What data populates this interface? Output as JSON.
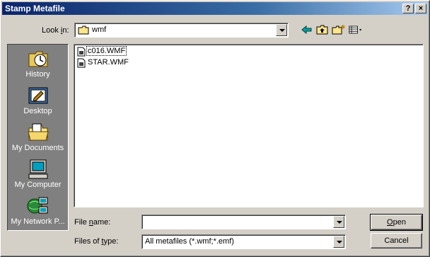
{
  "window": {
    "title": "Stamp Metafile",
    "help_btn": "?",
    "close_btn": "×"
  },
  "look_in": {
    "label_pre": "Look ",
    "label_key": "i",
    "label_post": "n:",
    "value": "wmf"
  },
  "places": [
    {
      "label": "History",
      "icon": "history-icon"
    },
    {
      "label": "Desktop",
      "icon": "desktop-icon"
    },
    {
      "label": "My Documents",
      "icon": "my-documents-icon"
    },
    {
      "label": "My Computer",
      "icon": "my-computer-icon"
    },
    {
      "label": "My Network P...",
      "icon": "my-network-places-icon"
    }
  ],
  "files": [
    {
      "name": "c016.WMF",
      "icon": "wmf-file-icon"
    },
    {
      "name": "STAR.WMF",
      "icon": "wmf-file-icon"
    }
  ],
  "file_name": {
    "label_pre": "File ",
    "label_key": "n",
    "label_post": "ame:",
    "value": ""
  },
  "file_type": {
    "label_pre": "Files of ",
    "label_key": "t",
    "label_post": "ype:",
    "value": "All metafiles (*.wmf;*.emf)"
  },
  "buttons": {
    "open_key": "O",
    "open_rest": "pen",
    "cancel": "Cancel"
  },
  "colors": {
    "titlebar": "#0a246a",
    "face": "#d4d0c8",
    "places_bg": "#808080"
  }
}
